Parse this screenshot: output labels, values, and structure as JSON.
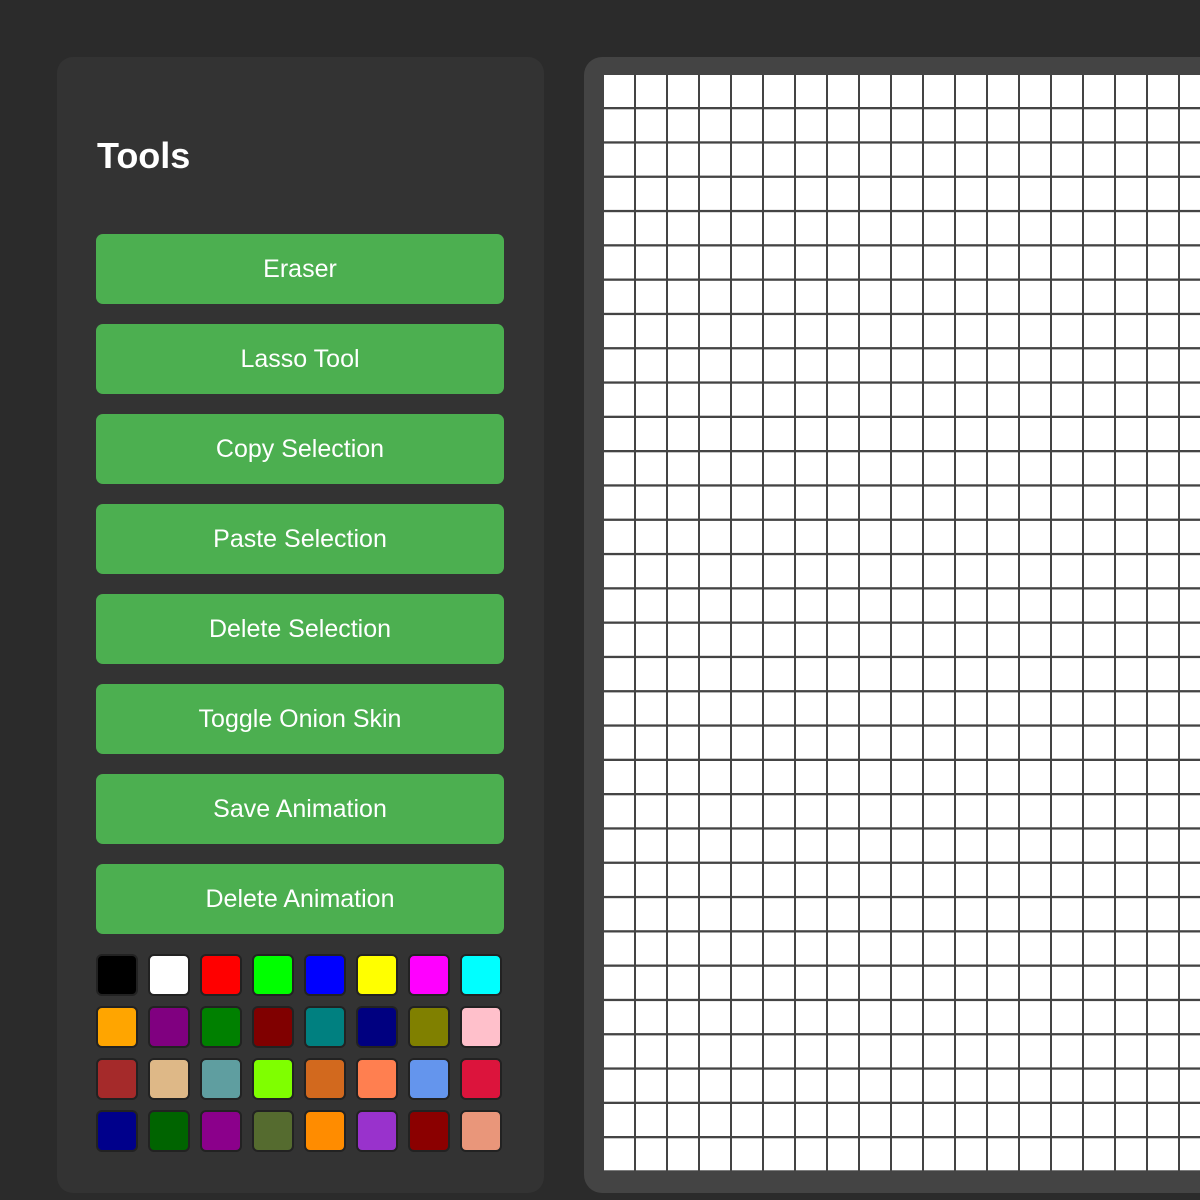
{
  "tools": {
    "title": "Tools",
    "buttons": [
      {
        "label": "Eraser"
      },
      {
        "label": "Lasso Tool"
      },
      {
        "label": "Copy Selection"
      },
      {
        "label": "Paste Selection"
      },
      {
        "label": "Delete Selection"
      },
      {
        "label": "Toggle Onion Skin"
      },
      {
        "label": "Save Animation"
      },
      {
        "label": "Delete Animation"
      }
    ],
    "button_color": "#4caf50"
  },
  "palette": {
    "colors": [
      "#000000",
      "#ffffff",
      "#ff0000",
      "#00ff00",
      "#0000ff",
      "#ffff00",
      "#ff00ff",
      "#00ffff",
      "#ffa500",
      "#800080",
      "#008000",
      "#800000",
      "#008080",
      "#000080",
      "#808000",
      "#ffc0cb",
      "#a52a2a",
      "#deb887",
      "#5f9ea0",
      "#7fff00",
      "#d2691e",
      "#ff7f50",
      "#6495ed",
      "#dc143c",
      "#00008b",
      "#006400",
      "#8b008b",
      "#556b2f",
      "#ff8c00",
      "#9932cc",
      "#8b0000",
      "#e9967a"
    ]
  },
  "canvas": {
    "cell_color": "#ffffff",
    "grid_line_color": "#444444"
  }
}
